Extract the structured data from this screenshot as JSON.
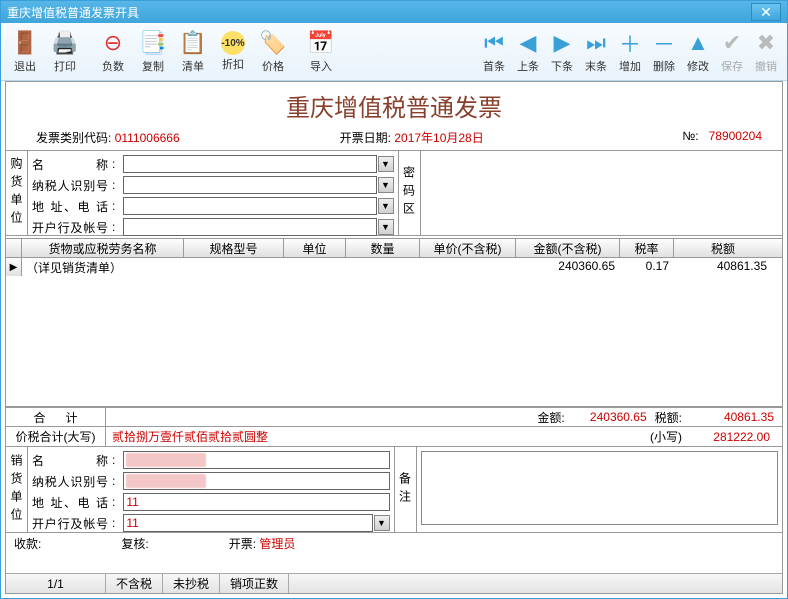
{
  "window": {
    "title": "重庆增值税普通发票开具"
  },
  "toolbar": {
    "exit": "退出",
    "print": "打印",
    "negative": "负数",
    "copy": "复制",
    "list": "清单",
    "discount": "折扣",
    "price": "价格",
    "import": "导入",
    "first": "首条",
    "prev": "上条",
    "next": "下条",
    "last": "末条",
    "add": "增加",
    "delete": "删除",
    "edit": "修改",
    "save": "保存",
    "undo": "撤销"
  },
  "doc": {
    "title": "重庆增值税普通发票"
  },
  "meta": {
    "type_code_label": "发票类别代码:",
    "type_code": "0111006666",
    "date_label": "开票日期:",
    "date": "2017年10月28日",
    "no_label": "№:",
    "no": "78900204"
  },
  "buyer": {
    "section": "购货单位",
    "name_label": "名　　称",
    "taxid_label": "纳税人识别号",
    "addr_label": "地 址、电 话",
    "bank_label": "开户行及帐号",
    "pwd_section": "密码区"
  },
  "grid": {
    "cols": [
      "货物或应税劳务名称",
      "规格型号",
      "单位",
      "数量",
      "单价(不含税)",
      "金额(不含税)",
      "税率",
      "税额"
    ],
    "rows": [
      {
        "name": "（详见销货清单）",
        "amount": "240360.65",
        "rate": "0.17",
        "tax": "40861.35"
      }
    ]
  },
  "totals": {
    "label": "合计",
    "amount_label": "金额:",
    "amount": "240360.65",
    "tax_label": "税额:",
    "tax": "40861.35"
  },
  "grand": {
    "label": "价税合计(大写)",
    "cn_amount": "贰拾捌万壹仟贰佰贰拾贰圆整",
    "small_label": "(小写)",
    "amount": "281222.00"
  },
  "seller": {
    "section": "销货单位",
    "name_label": "名　　称",
    "taxid_label": "纳税人识别号",
    "addr_label": "地 址、电 话",
    "addr": "11",
    "bank_label": "开户行及帐号",
    "bank": "11",
    "remark_section": "备注"
  },
  "sign": {
    "payee_label": "收款:",
    "reviewer_label": "复核:",
    "issuer_label": "开票:",
    "issuer": "管理员"
  },
  "status": {
    "page": "1/1",
    "tax_inc": "不含税",
    "copy_tax": "未抄税",
    "sales": "销项正数"
  }
}
